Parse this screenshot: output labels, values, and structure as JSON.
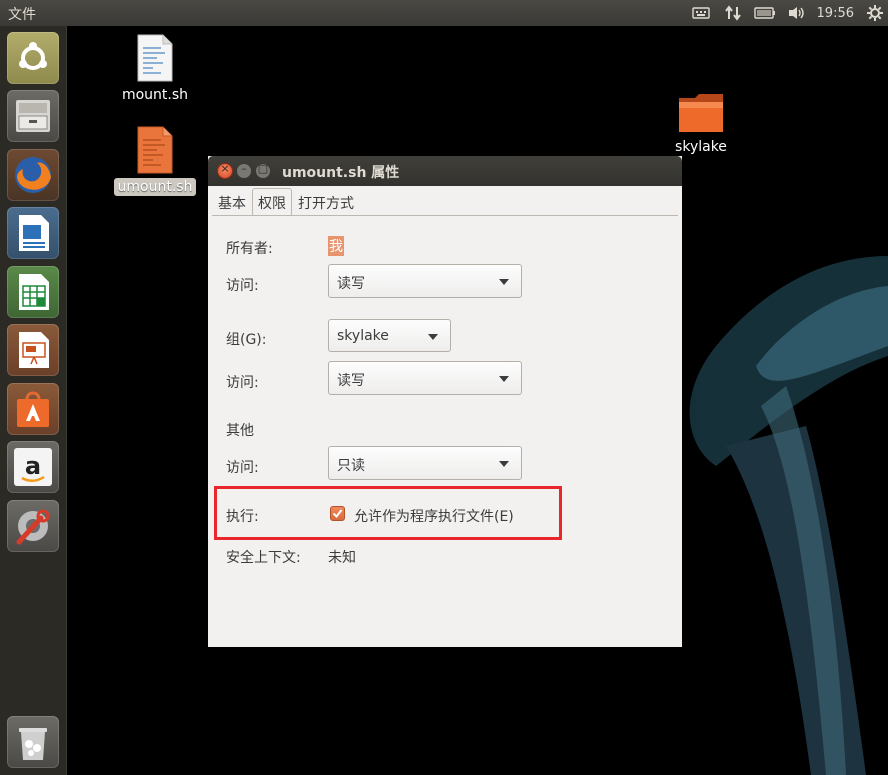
{
  "topbar": {
    "app_menu": "文件",
    "clock": "19:56",
    "indicators": [
      "keyboard-icon",
      "network-arrows-icon",
      "battery-icon",
      "volume-icon"
    ]
  },
  "launcher": {
    "items": [
      "ubuntu-dash",
      "files",
      "firefox",
      "libreoffice-writer",
      "libreoffice-calc",
      "libreoffice-impress",
      "software-center",
      "amazon",
      "system-settings",
      "trash"
    ]
  },
  "desktop": {
    "icons": [
      {
        "label": "mount.sh"
      },
      {
        "label": "umount.sh"
      },
      {
        "label": "skylake"
      }
    ]
  },
  "window": {
    "title": "umount.sh 属性",
    "tabs": [
      "基本",
      "权限",
      "打开方式"
    ],
    "owner_label": "所有者:",
    "owner_value": "我",
    "access_label": "访问:",
    "owner_access": "读写",
    "group_label": "组(G):",
    "group_value": "skylake",
    "group_access": "读写",
    "others_label": "其他",
    "others_access": "只读",
    "exec_label": "执行:",
    "exec_checkbox": "允许作为程序执行文件(E)",
    "exec_checked": true,
    "context_label": "安全上下文:",
    "context_value": "未知"
  },
  "colors": {
    "accent": "#dd4814",
    "highlight_box": "#e8262b"
  }
}
